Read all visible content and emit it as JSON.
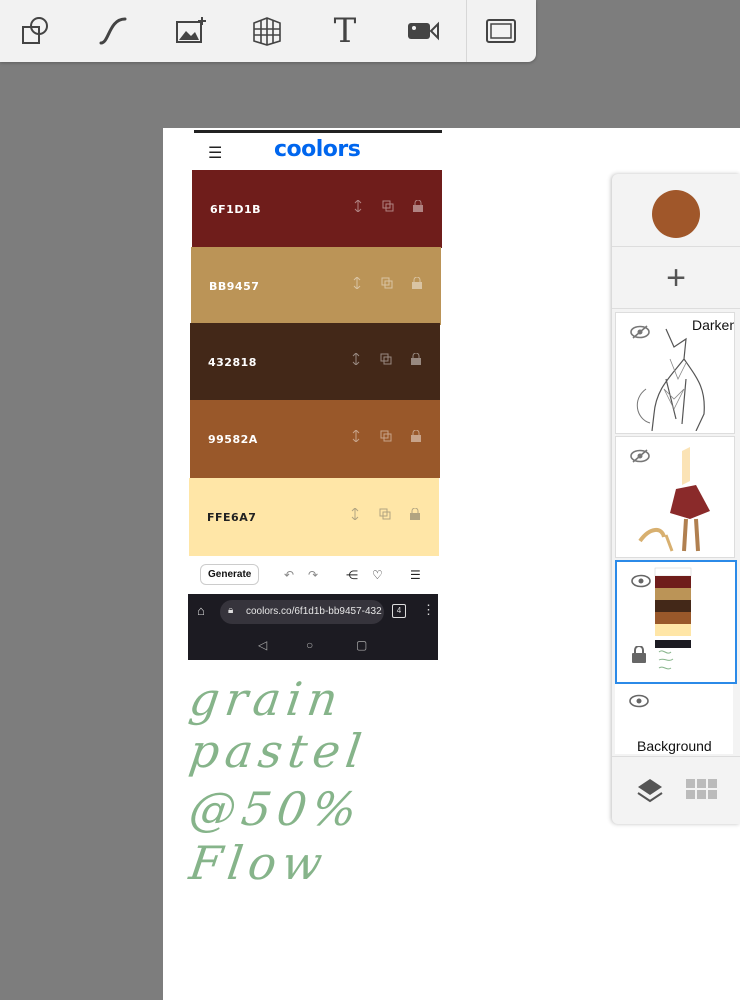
{
  "toolbar": {
    "tools": [
      {
        "name": "shapes-icon"
      },
      {
        "name": "curve-icon"
      },
      {
        "name": "image-add-icon"
      },
      {
        "name": "perspective-grid-icon"
      },
      {
        "name": "text-icon",
        "glyph": "T"
      },
      {
        "name": "video-icon"
      },
      {
        "name": "frame-icon"
      }
    ]
  },
  "screenshot": {
    "logo": "coolors",
    "palette": [
      {
        "hex": "6F1D1B",
        "color": "#6F1D1B",
        "text_color": "#ffffff"
      },
      {
        "hex": "BB9457",
        "color": "#BB9457",
        "text_color": "#ffffff"
      },
      {
        "hex": "432818",
        "color": "#432818",
        "text_color": "#ffffff"
      },
      {
        "hex": "99582A",
        "color": "#99582A",
        "text_color": "#ffffff"
      },
      {
        "hex": "FFE6A7",
        "color": "#FFE6A7",
        "text_color": "#222222"
      }
    ],
    "generate_label": "Generate",
    "url": "coolors.co/6f1d1b-bb9457-432",
    "tab_count": "4"
  },
  "note": {
    "lines": [
      "grain",
      "pastel",
      "@50%",
      "Flow"
    ],
    "color": "#86b48a"
  },
  "layers_panel": {
    "current_color": "#a0572a",
    "add_label": "+",
    "layers": [
      {
        "blend_label": "Darken",
        "visible": false
      },
      {
        "blend_label": "",
        "visible": false
      },
      {
        "blend_label": "",
        "visible": true,
        "selected": true,
        "locked": true
      },
      {
        "name_label": "Background",
        "visible": true
      }
    ]
  }
}
